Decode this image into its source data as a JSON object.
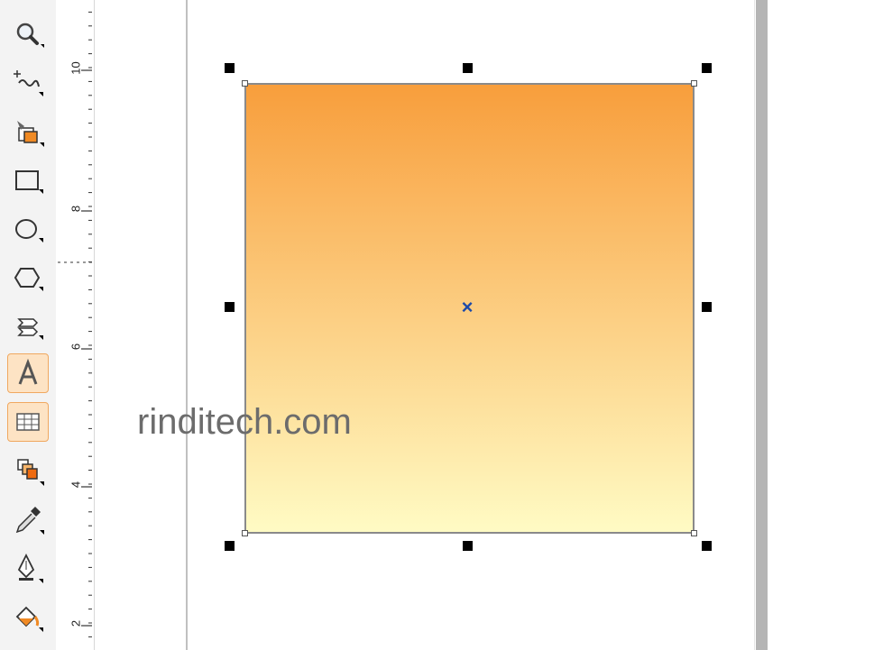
{
  "colors": {
    "gradient_top": "#f89e3c",
    "gradient_bottom": "#fffbc4",
    "outline": "#8a8a8a",
    "center_marker": "#1d4aa8",
    "active_tool_bg": "#fde3c4"
  },
  "toolbox": {
    "tools": [
      {
        "name": "zoom-tool",
        "icon": "magnifier-icon"
      },
      {
        "name": "freehand-tool",
        "icon": "freehand-curve-icon"
      },
      {
        "name": "smart-fill-tool",
        "icon": "smart-fill-icon"
      },
      {
        "name": "rectangle-tool",
        "icon": "rectangle-icon"
      },
      {
        "name": "ellipse-tool",
        "icon": "ellipse-icon"
      },
      {
        "name": "polygon-tool",
        "icon": "polygon-icon"
      },
      {
        "name": "basic-shapes-tool",
        "icon": "basic-shapes-icon"
      },
      {
        "name": "text-tool",
        "icon": "text-a-icon",
        "active": true
      },
      {
        "name": "table-tool",
        "icon": "table-icon",
        "active": true
      },
      {
        "name": "interactive-blend-tool",
        "icon": "blend-icon"
      },
      {
        "name": "eyedropper-tool",
        "icon": "eyedropper-icon"
      },
      {
        "name": "outline-pen-tool",
        "icon": "pen-nib-icon"
      },
      {
        "name": "fill-tool",
        "icon": "paint-bucket-icon"
      }
    ]
  },
  "ruler": {
    "labels": [
      "10",
      "8",
      "6",
      "4",
      "2"
    ]
  },
  "selection": {
    "center_marker": "×"
  },
  "watermark": {
    "text": "rinditech.com"
  }
}
